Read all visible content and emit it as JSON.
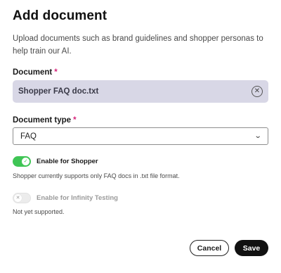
{
  "dialog": {
    "title": "Add document",
    "description": "Upload documents such as brand guidelines and shopper personas to help train our AI."
  },
  "document": {
    "label": "Document",
    "required_mark": "*",
    "file_name": "Shopper FAQ doc.txt",
    "clear_icon": "circle-x-icon"
  },
  "document_type": {
    "label": "Document type",
    "required_mark": "*",
    "selected": "FAQ",
    "chevron_icon": "chevron-down-icon"
  },
  "shopper_toggle": {
    "label": "Enable for Shopper",
    "enabled": true,
    "helper": "Shopper currently supports only FAQ docs in .txt file format."
  },
  "infinity_toggle": {
    "label": "Enable for Infinity Testing",
    "enabled": false,
    "helper": "Not yet supported."
  },
  "actions": {
    "cancel_label": "Cancel",
    "save_label": "Save"
  },
  "colors": {
    "toggle_on": "#3fc555",
    "required": "#d6247a",
    "file_box_bg": "#d8d7e6",
    "primary_button": "#111111"
  }
}
